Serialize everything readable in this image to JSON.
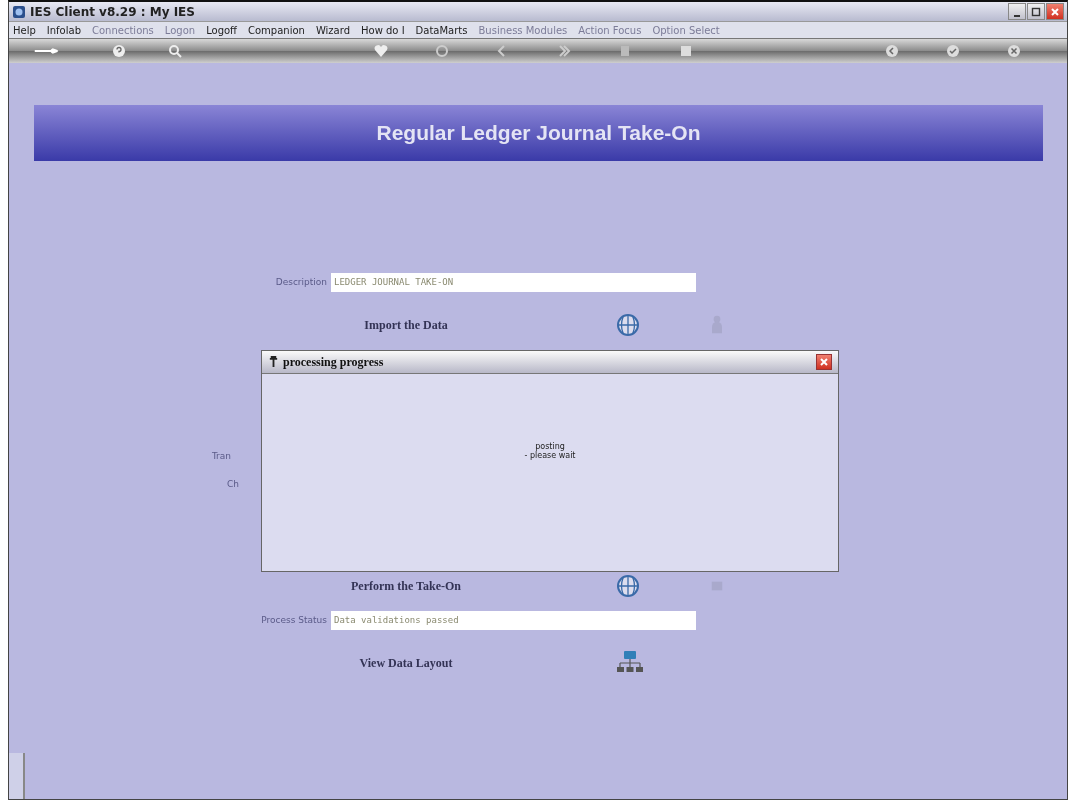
{
  "window": {
    "title": "IES Client v8.29 : My IES"
  },
  "menu": [
    {
      "label": "Help",
      "disabled": false
    },
    {
      "label": "Infolab",
      "disabled": false
    },
    {
      "label": "Connections",
      "disabled": true
    },
    {
      "label": "Logon",
      "disabled": true
    },
    {
      "label": "Logoff",
      "disabled": false
    },
    {
      "label": "Companion",
      "disabled": false
    },
    {
      "label": "Wizard",
      "disabled": false
    },
    {
      "label": "How do I",
      "disabled": false
    },
    {
      "label": "DataMarts",
      "disabled": false
    },
    {
      "label": "Business Modules",
      "disabled": true
    },
    {
      "label": "Action Focus",
      "disabled": true
    },
    {
      "label": "Option Select",
      "disabled": true
    }
  ],
  "banner": {
    "title": "Regular Ledger Journal Take-On"
  },
  "form": [
    {
      "kind": "field",
      "label": "Description",
      "value": "LEDGER JOURNAL TAKE-ON"
    },
    {
      "kind": "action",
      "label": "Import the Data"
    },
    {
      "kind": "label",
      "label": "Tran"
    },
    {
      "kind": "label",
      "label": "Ch"
    },
    {
      "kind": "action",
      "label": "Perform the Take-On"
    },
    {
      "kind": "field",
      "label": "Process Status",
      "value": "Data validations passed"
    },
    {
      "kind": "action",
      "label": "View Data Layout"
    }
  ],
  "dialog": {
    "title": "processing progress",
    "message": "posting\n- please wait"
  }
}
